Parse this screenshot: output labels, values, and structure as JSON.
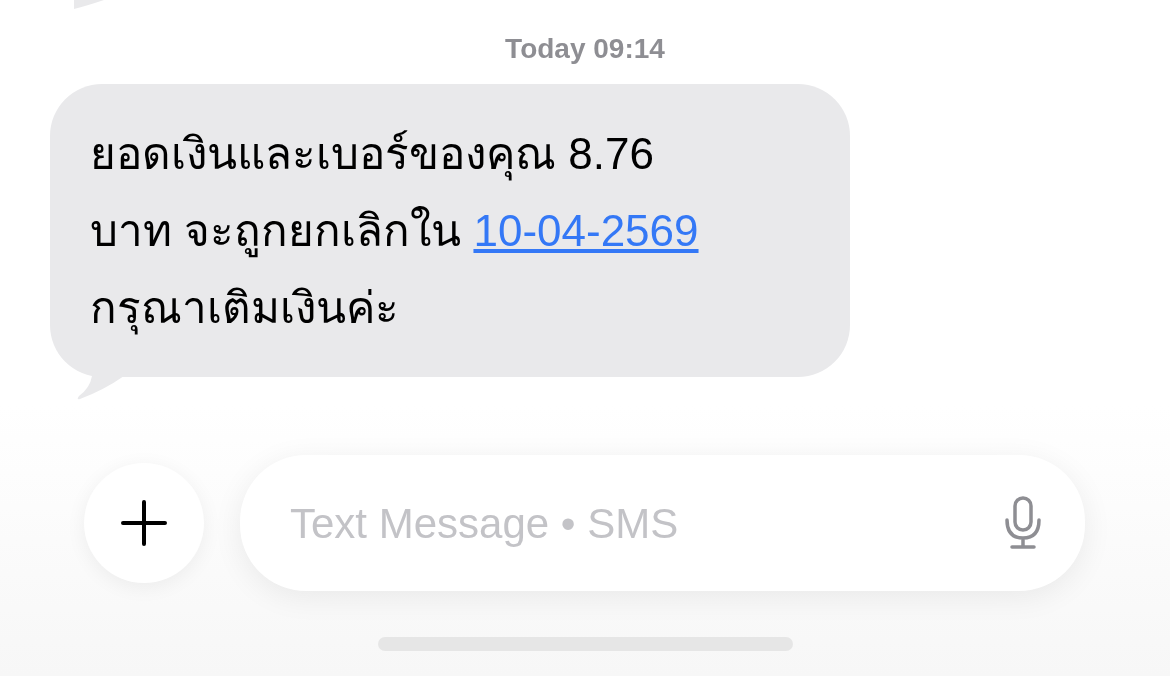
{
  "timestamp": {
    "day": "Today",
    "time": "09:14"
  },
  "message": {
    "text": "ยอดเงินและเบอร์ของคุณ 8.76 บาท จะถูกยกเลิกใน",
    "link": "10-04-2569",
    "text_after": "กรุณาเติมเงินค่ะ"
  },
  "composer": {
    "placeholder": "Text Message • SMS"
  }
}
